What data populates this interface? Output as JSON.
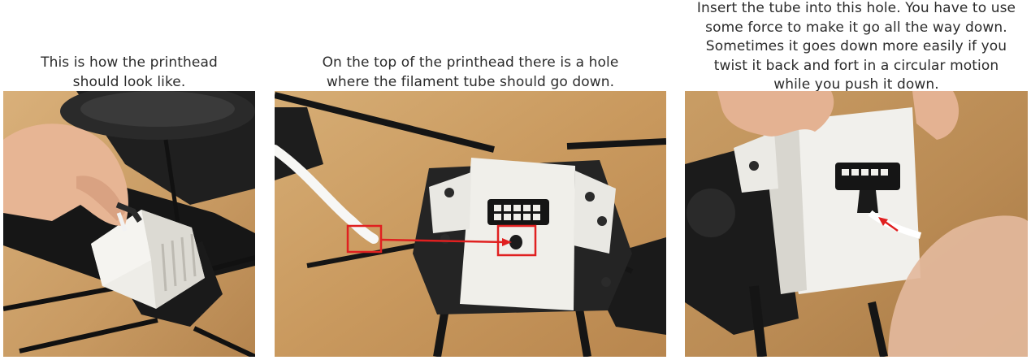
{
  "panels": [
    {
      "caption": [
        "This is how the printhead",
        "should look like."
      ]
    },
    {
      "caption": [
        "On the top of the printhead there is a hole",
        "where the filament tube should go down."
      ]
    },
    {
      "caption": [
        "Insert the tube into this hole. You have to use",
        "some force to make it go all the way down.",
        "Sometimes it goes down more easily if you",
        "twist it back and fort in a circular motion",
        "while you push it down."
      ]
    }
  ],
  "colors": {
    "annotation_red": "#e02020",
    "printhead_white": "#f1f0ec",
    "dark_parts": "#1c1c1c",
    "wood": "#c89a62"
  }
}
